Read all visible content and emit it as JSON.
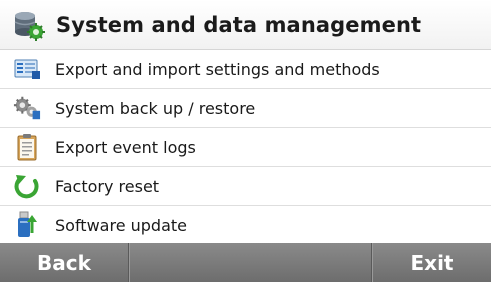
{
  "header": {
    "title": "System and data management",
    "icon": "database-gear-icon"
  },
  "menu": {
    "items": [
      {
        "label": "Export and import settings and methods",
        "icon": "export-import-icon"
      },
      {
        "label": "System back up / restore",
        "icon": "gears-backup-icon"
      },
      {
        "label": "Export event logs",
        "icon": "clipboard-log-icon"
      },
      {
        "label": "Factory reset",
        "icon": "reset-arrow-icon"
      },
      {
        "label": "Software update",
        "icon": "usb-update-icon"
      }
    ]
  },
  "footer": {
    "back_label": "Back",
    "exit_label": "Exit"
  },
  "colors": {
    "footer_bg": "#7a7a7a",
    "accent_blue": "#2b6fc0",
    "accent_green": "#3aa534"
  }
}
